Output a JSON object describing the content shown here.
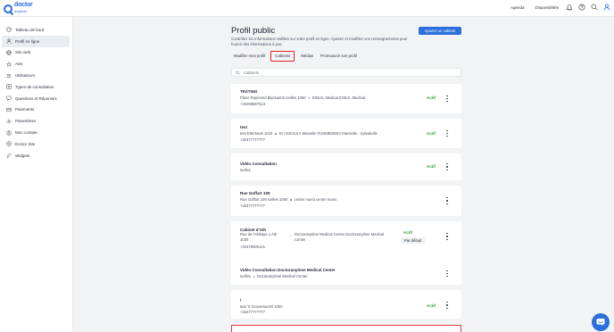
{
  "brand": {
    "line1": "doctor",
    "line2": "anytime"
  },
  "topnav": {
    "agenda": "Agenda",
    "disponibilites": "Disponibilités"
  },
  "sidebar": {
    "items": [
      {
        "label": "Tableau de bord",
        "icon": "dashboard-icon"
      },
      {
        "label": "Profil en ligne",
        "icon": "profile-icon"
      },
      {
        "label": "Site web",
        "icon": "globe-icon"
      },
      {
        "label": "Avis",
        "icon": "star-icon"
      },
      {
        "label": "Utilisateurs",
        "icon": "users-icon"
      },
      {
        "label": "Types de consultation",
        "icon": "list-icon"
      },
      {
        "label": "Questions et Réponses",
        "icon": "chat-icon"
      },
      {
        "label": "Paiements",
        "icon": "card-icon"
      },
      {
        "label": "Paramètres",
        "icon": "gear-icon"
      },
      {
        "label": "Mon compte",
        "icon": "account-icon"
      },
      {
        "label": "Doctor Site",
        "icon": "site-icon"
      },
      {
        "label": "Widgets",
        "icon": "widget-icon"
      }
    ]
  },
  "page": {
    "title": "Profil public",
    "subtitle": "Contrôlez les informations visibles sur votre profil en ligne. Ajoutez et modifiez vos renseignements pour fournir des informations à jour.",
    "add_button": "Ajouter un cabinet",
    "tabs": [
      "Modifier mon profil",
      "Cabinets",
      "Médias",
      "Promouvoir son profil"
    ],
    "search_placeholder": "Cabinets"
  },
  "cabinets": [
    {
      "name": "TESTING",
      "line1": [
        "Place Raymond Blyckaerts Ixelles 1050",
        "ESEAL Medical ESEAL Medical"
      ],
      "phone": "+32468587513",
      "status": "Actif"
    },
    {
      "name": "test",
      "line1": [
        "test Etterbeek 1040",
        "Dr ASSOULY Marselle FUNMEDDEV Marseille - Sylvabelle"
      ],
      "phone": "+32477777777",
      "status": "Actif"
    },
    {
      "name": "Vidéo Consultation",
      "line1": [
        "Ixelles"
      ],
      "phone": "",
      "status": "Actif"
    },
    {
      "name": "Rue Goffart 109",
      "line1": [
        "Rue Goffart 109 Ixelles 1050",
        "centre mario centre mario"
      ],
      "phone": "+32477777777",
      "status": ""
    },
    {
      "name": "Cabinet d'Ath",
      "address": "Rue de l'Abbaye 1 Ath 1030",
      "org": "Doctoranytime Medical Center Doctoranytime Medical Center",
      "phone": "+32478500121",
      "status": "Actif",
      "default": "Par défaut"
    },
    {
      "name": "Vidéo Consultation Doctoranytime Medical Center",
      "line1": [
        "Ixelles",
        "Doctoranytime Medical Center"
      ],
      "phone": "",
      "status": ""
    },
    {
      "name": "/",
      "line1": [
        "test 'S Gravenwezel 1000"
      ],
      "phone": "+32477777777",
      "status": "Actif"
    }
  ],
  "colors": {
    "accent": "#2a6fdb",
    "active_green": "#2b9a3a",
    "tab_highlight": "#e02424"
  }
}
